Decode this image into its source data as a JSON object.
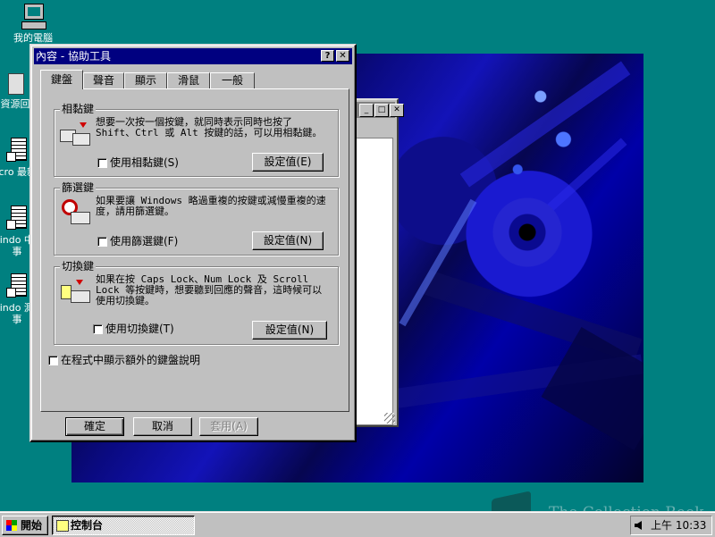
{
  "desktop": {
    "icons": [
      {
        "label": "我的電腦"
      },
      {
        "label": "資源回"
      },
      {
        "label": "Micro 最新鮮"
      },
      {
        "label": "Windo 中文 事"
      },
      {
        "label": "Windo 測試 事"
      }
    ]
  },
  "dialog": {
    "title": "內容 - 協助工具",
    "help_button": "?",
    "close_button": "✕",
    "tabs": [
      {
        "label": "鍵盤",
        "active": true
      },
      {
        "label": "聲音",
        "active": false
      },
      {
        "label": "顯示",
        "active": false
      },
      {
        "label": "滑鼠",
        "active": false
      },
      {
        "label": "一般",
        "active": false
      }
    ],
    "groups": [
      {
        "title": "相黏鍵",
        "description": "想要一次按一個按鍵，就同時表示同時也按了 Shift、Ctrl 或 Alt 按鍵的話，可以用相黏鍵。",
        "checkbox_label": "使用相黏鍵(S)",
        "checked": false,
        "settings_label": "設定值(E)"
      },
      {
        "title": "篩選鍵",
        "description": "如果要讓 Windows 略過重複的按鍵或減慢重複的速度，請用篩選鍵。",
        "checkbox_label": "使用篩選鍵(F)",
        "checked": false,
        "settings_label": "設定值(N)"
      },
      {
        "title": "切換鍵",
        "description": "如果在按 Caps Lock、Num Lock 及 Scroll Lock 等按鍵時，想要聽到回應的聲音，這時候可以使用切換鍵。",
        "checkbox_label": "使用切換鍵(T)",
        "checked": false,
        "settings_label": "設定值(N)"
      }
    ],
    "extra_help_checkbox": {
      "label": "在程式中顯示額外的鍵盤說明",
      "checked": false
    },
    "buttons": {
      "ok": "確定",
      "cancel": "取消",
      "apply": "套用(A)"
    }
  },
  "taskbar": {
    "start_label": "開始",
    "tasks": [
      {
        "label": "控制台"
      }
    ],
    "clock": "上午 10:33"
  },
  "watermark": {
    "text": "The Collection Book"
  }
}
